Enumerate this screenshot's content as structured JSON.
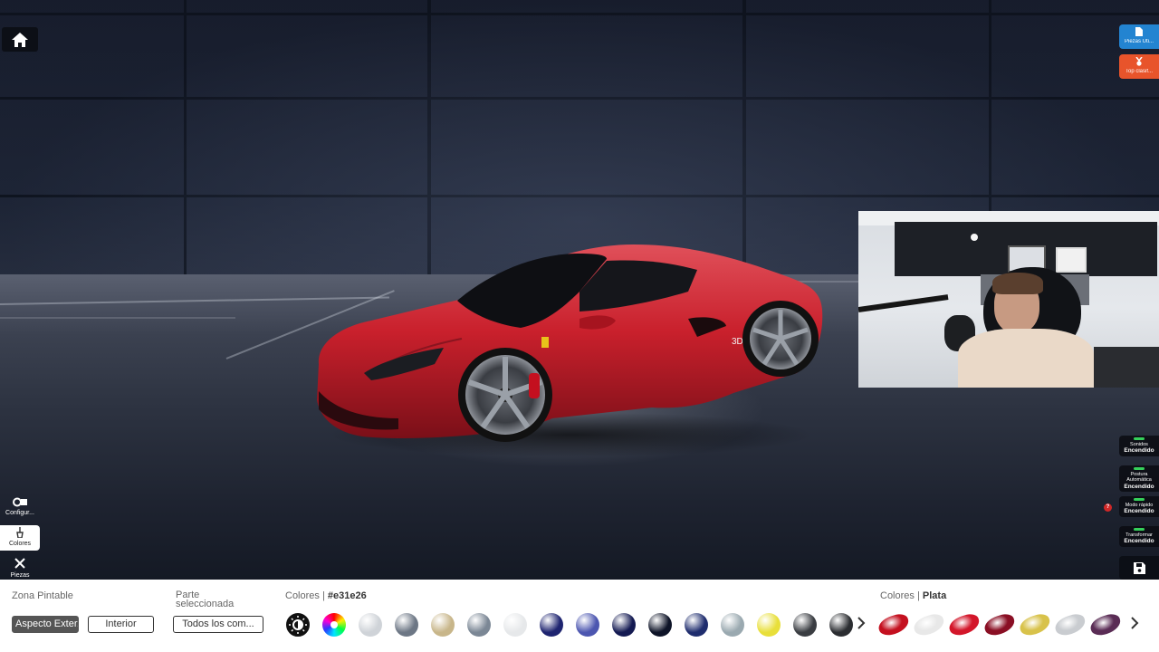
{
  "top": {
    "home_icon": "home-icon",
    "parts_button": {
      "label": "Piezas Uti...",
      "icon": "document-icon",
      "color": "#2384d1"
    },
    "ranking_button": {
      "label": "Top clasif...",
      "icon": "medal-icon",
      "color": "#e8542b"
    }
  },
  "left_tools": [
    {
      "label": "Configur...",
      "icon": "settings-icon",
      "active": false
    },
    {
      "label": "Colores",
      "icon": "paint-icon",
      "active": true
    },
    {
      "label": "Piezas",
      "icon": "wrench-icon",
      "active": false
    }
  ],
  "right_toggles": [
    {
      "title": "Sonidos",
      "state": "Encendido"
    },
    {
      "title": "Postura Automática",
      "state": "Encendido"
    },
    {
      "title": "Modo rápido",
      "state": "Encendido"
    },
    {
      "title": "Transformar",
      "state": "Encendido"
    }
  ],
  "help_badge": "?",
  "save_icon": "save-icon",
  "bottom": {
    "zone_label": "Zona Pintable",
    "zone_exterior": "Aspecto Exter...",
    "zone_interior": "Interior",
    "part_label": "Parte seleccionada",
    "part_select": "Todos los com...",
    "colors_label": "Colores",
    "colors_value": "#e31e26",
    "paint_colors": [
      "#cfd3d8",
      "#6d7785",
      "#c8b68a",
      "#7b8795",
      "#e6e8ea",
      "#1e2470",
      "#4c56b0",
      "#141a52",
      "#0e1428",
      "#1f2d6e",
      "#9aa9b0",
      "#e8df3a",
      "#3a3d42",
      "#2b2d31"
    ],
    "finish_label": "Colores",
    "finish_value": "Plata",
    "finish_colors": [
      "#c4101f",
      "#e8e8e8",
      "#d3162a",
      "#8a0f24",
      "#d8c24a",
      "#c9ccd0",
      "#5a2c55"
    ],
    "next_icon": "chevron-right-icon"
  }
}
